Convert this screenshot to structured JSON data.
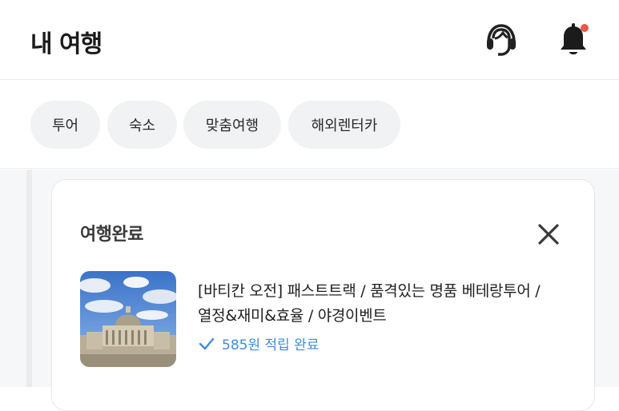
{
  "header": {
    "title": "내 여행",
    "icons": {
      "support": "headset-icon",
      "notifications": "bell-icon"
    },
    "notification_dot_color": "#e8584b"
  },
  "tabs": [
    {
      "label": "투어"
    },
    {
      "label": "숙소"
    },
    {
      "label": "맞춤여행"
    },
    {
      "label": "해외렌터카"
    }
  ],
  "card": {
    "status_title": "여행완료",
    "close_icon": "close-icon",
    "thumbnail": "st-peters-basilica-image",
    "tour_title_line1": "[바티칸 오전] 패스트트랙 / 품격있는 명품 베테랑투어 /",
    "tour_title_line2": "열정&재미&효율 / 야경이벤트",
    "points_text": "585원 적립 완료",
    "points_icon": "check-icon",
    "accent_color": "#3e8de0"
  }
}
